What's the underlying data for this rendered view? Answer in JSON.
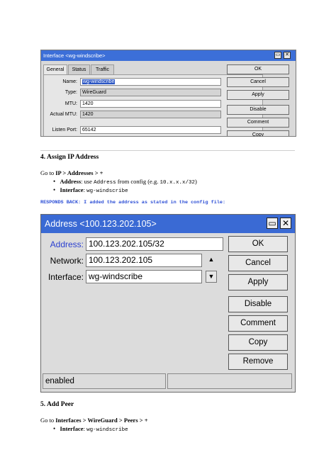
{
  "window1": {
    "title": "Interface <wg-windscribe>",
    "tabs": [
      "General",
      "Status",
      "Traffic"
    ],
    "fields": [
      {
        "label": "Name:",
        "value": "wg-windscribe"
      },
      {
        "label": "Type:",
        "value": "WireGuard"
      },
      {
        "label": "MTU:",
        "value": "1420"
      },
      {
        "label": "Actual MTU:",
        "value": "1420"
      },
      {
        "label": "Listen Port:",
        "value": "65142"
      }
    ],
    "buttons": [
      "OK",
      "Cancel",
      "Apply",
      "Disable",
      "Comment",
      "Copy"
    ]
  },
  "section4": {
    "heading": "4. Assign IP Address",
    "goto_prefix": "Go to ",
    "goto_path": "IP > Addresses > +",
    "bullets": [
      {
        "bold": "Address",
        "text": ": use ",
        "code": "Address",
        "text2": " from config (e.g. ",
        "code2": "10.x.x.x/32",
        "text3": ")"
      },
      {
        "bold": "Interface",
        "text": ": ",
        "code": "wg-windscribe"
      }
    ],
    "responds": "RESPONDS BACK: I added the address as stated in the config file:"
  },
  "window2": {
    "title": "Address <100.123.202.105>",
    "address_label": "Address:",
    "address_value": "100.123.202.105/32",
    "network_label": "Network:",
    "network_value": "100.123.202.105",
    "interface_label": "Interface:",
    "interface_value": "wg-windscribe",
    "buttons": [
      "OK",
      "Cancel",
      "Apply",
      "Disable",
      "Comment",
      "Copy",
      "Remove"
    ],
    "status": "enabled"
  },
  "section5": {
    "heading": "5. Add Peer",
    "goto_prefix": "Go to ",
    "goto_path": "Interfaces > WireGuard > Peers > +",
    "bullets": [
      {
        "bold": "Interface",
        "text": ": ",
        "code": "wg-windscribe"
      }
    ]
  },
  "icons": {
    "restore": "restore-icon",
    "close": "close-icon",
    "arrow_up": "triangle-up-icon",
    "arrow_down": "triangle-down-icon"
  },
  "colors": {
    "titlebar": "#3a6ad4",
    "responds": "#2d4fd6"
  }
}
